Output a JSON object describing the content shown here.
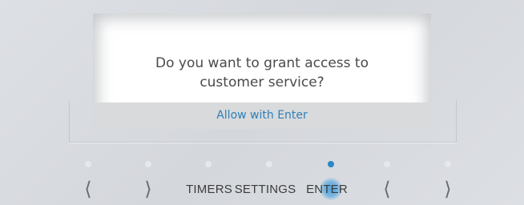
{
  "dialog": {
    "line1": "Do you want to grant access to",
    "line2": "customer service?",
    "action_label": "Allow with Enter"
  },
  "controls": {
    "prev": "⟨",
    "next": "⟩",
    "timers": "TIMERS",
    "settings": "SETTINGS",
    "enter": "ENTER",
    "prev2": "⟨",
    "next2": "⟩"
  },
  "indicators": {
    "active_index": 4,
    "count": 7
  },
  "colors": {
    "accent": "#2b87c9",
    "action_text": "#2f7fb8"
  }
}
